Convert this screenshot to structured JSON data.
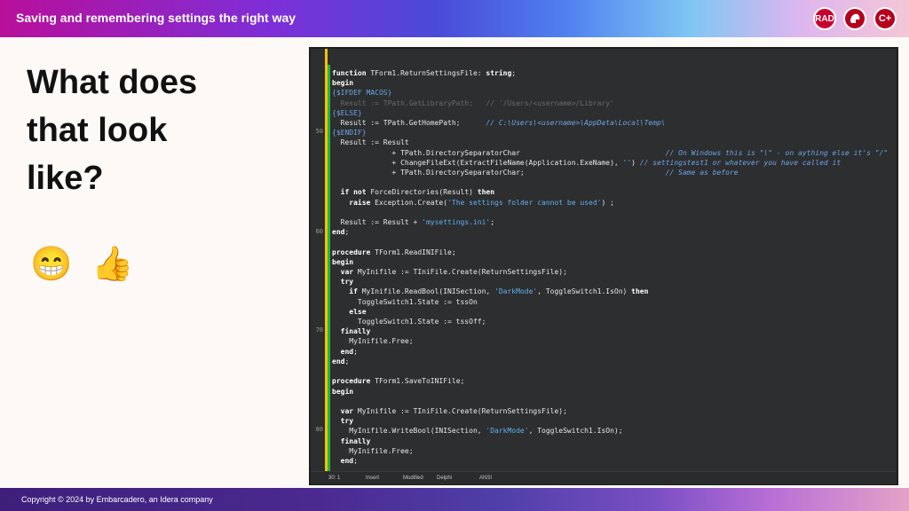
{
  "header": {
    "title": "Saving and remembering settings the right way"
  },
  "logos": [
    {
      "name": "rad-logo",
      "text": "RAD"
    },
    {
      "name": "delphi-helmet-logo",
      "text": ""
    },
    {
      "name": "cpp-logo",
      "text": "C+"
    }
  ],
  "slide": {
    "heading_lines": [
      "What does",
      "that look",
      "like?"
    ],
    "emojis": [
      "😁",
      "👍"
    ]
  },
  "editor": {
    "line_numbers": {
      "l50": "50",
      "l60": "60",
      "l70": "70",
      "l80": "80"
    },
    "code_lines": [
      "function TForm1.ReturnSettingsFile: string;",
      "begin",
      "{$IFDEF MACOS}",
      "  Result := TPath.GetLibraryPath;   // '/Users/<username>/Library'",
      "{$ELSE}",
      "  Result := TPath.GetHomePath;      // C:\\Users\\<username>\\AppData\\Local\\Temp\\",
      "{$ENDIF}",
      "  Result := Result",
      "              + TPath.DirectorySeparatorChar                                  // On Windows this is \"\\\" - on aything else it's \"/\"",
      "              + ChangeFileExt(ExtractFileName(Application.ExeName), '') // settingstest1 or whatever you have called it",
      "              + TPath.DirectorySeparatorChar;                                 // Same as before",
      "",
      "  if not ForceDirectories(Result) then",
      "    raise Exception.Create('The settings folder cannot be used') ;",
      "",
      "  Result := Result + 'mysettings.ini';",
      "end;",
      "",
      "procedure TForm1.ReadINIFile;",
      "begin",
      "  var MyInifile := TIniFile.Create(ReturnSettingsFile);",
      "  try",
      "    if MyInifile.ReadBool(INISection, 'DarkMode', ToggleSwitch1.IsOn) then",
      "      ToggleSwitch1.State := tssOn",
      "    else",
      "      ToggleSwitch1.State := tssOff;",
      "  finally",
      "    MyInifile.Free;",
      "  end;",
      "end;",
      "",
      "procedure TForm1.SaveToINIFile;",
      "begin",
      "",
      "  var MyInifile := TIniFile.Create(ReturnSettingsFile);",
      "  try",
      "    MyInifile.WriteBool(INISection, 'DarkMode', ToggleSwitch1.IsOn);",
      "  finally",
      "    MyInifile.Free;",
      "  end;"
    ],
    "status": {
      "position": "30: 1",
      "mode": "Insert",
      "state": "Modified",
      "language": "Delphi",
      "encoding": "ANSI"
    }
  },
  "footer": {
    "copyright": "Copyright © 2024  by Embarcadero, an Idera company"
  }
}
